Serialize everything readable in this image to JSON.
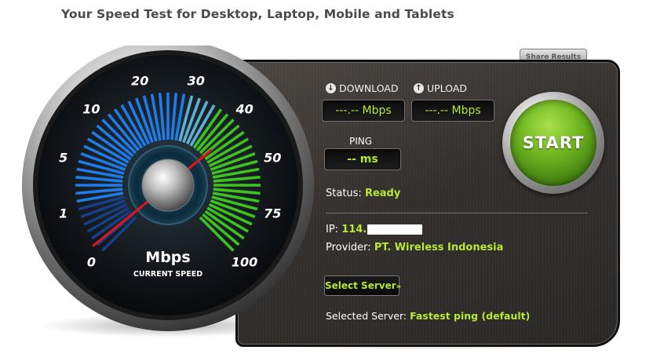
{
  "page": {
    "title": "Your Speed Test for Desktop, Laptop, Mobile and Tablets"
  },
  "share": {
    "label": "Share Results"
  },
  "gauge": {
    "unit": "Mbps",
    "caption": "CURRENT SPEED",
    "scale_labels": [
      "0",
      "1",
      "5",
      "10",
      "20",
      "30",
      "40",
      "50",
      "75",
      "100"
    ],
    "needle_value_label": "40"
  },
  "download": {
    "label": "DOWNLOAD",
    "value": "---.-- Mbps",
    "icon": "download-arrow-icon"
  },
  "upload": {
    "label": "UPLOAD",
    "value": "---.-- Mbps",
    "icon": "upload-arrow-icon"
  },
  "ping": {
    "label": "PING",
    "value": "-- ms"
  },
  "status": {
    "label": "Status:",
    "value": "Ready"
  },
  "ip": {
    "label": "IP:",
    "value": "114."
  },
  "provider": {
    "label": "Provider:",
    "value": "PT. Wireless Indonesia"
  },
  "server": {
    "select_label": "Select Server",
    "chevron": "»",
    "selected_label": "Selected Server:",
    "selected_value": "Fastest ping (default)"
  },
  "start": {
    "label": "START"
  },
  "colors": {
    "accent_green": "#b8e832",
    "scale_blue": "#1e7be8",
    "scale_green": "#3ec21f",
    "needle_red": "#e4141b",
    "panel_bg": "#33302e"
  }
}
